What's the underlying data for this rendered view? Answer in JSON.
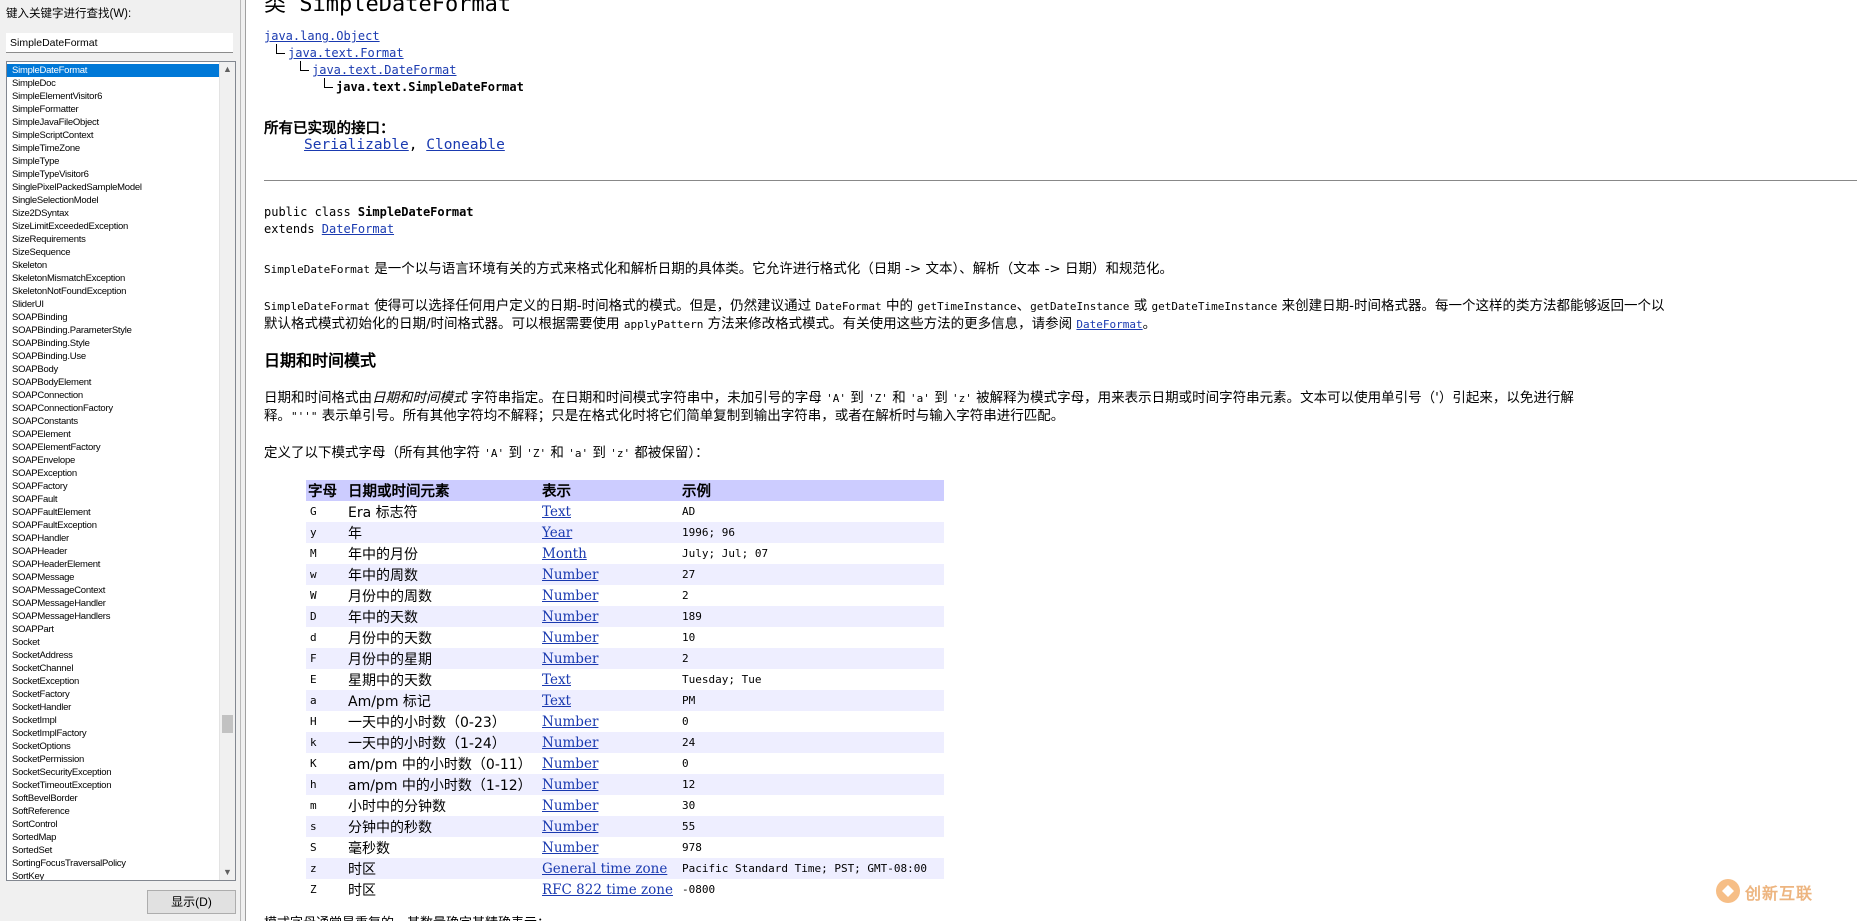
{
  "left_pane": {
    "search_label": "键入关键字进行查找(W):",
    "search_value": "SimpleDateFormat",
    "show_button": "显示(D)",
    "index_items": [
      "SimpleDateFormat",
      "SimpleDoc",
      "SimpleElementVisitor6",
      "SimpleFormatter",
      "SimpleJavaFileObject",
      "SimpleScriptContext",
      "SimpleTimeZone",
      "SimpleType",
      "SimpleTypeVisitor6",
      "SinglePixelPackedSampleModel",
      "SingleSelectionModel",
      "Size2DSyntax",
      "SizeLimitExceededException",
      "SizeRequirements",
      "SizeSequence",
      "Skeleton",
      "SkeletonMismatchException",
      "SkeletonNotFoundException",
      "SliderUI",
      "SOAPBinding",
      "SOAPBinding.ParameterStyle",
      "SOAPBinding.Style",
      "SOAPBinding.Use",
      "SOAPBody",
      "SOAPBodyElement",
      "SOAPConnection",
      "SOAPConnectionFactory",
      "SOAPConstants",
      "SOAPElement",
      "SOAPElementFactory",
      "SOAPEnvelope",
      "SOAPException",
      "SOAPFactory",
      "SOAPFault",
      "SOAPFaultElement",
      "SOAPFaultException",
      "SOAPHandler",
      "SOAPHeader",
      "SOAPHeaderElement",
      "SOAPMessage",
      "SOAPMessageContext",
      "SOAPMessageHandler",
      "SOAPMessageHandlers",
      "SOAPPart",
      "Socket",
      "SocketAddress",
      "SocketChannel",
      "SocketException",
      "SocketFactory",
      "SocketHandler",
      "SocketImpl",
      "SocketImplFactory",
      "SocketOptions",
      "SocketPermission",
      "SocketSecurityException",
      "SocketTimeoutException",
      "SoftBevelBorder",
      "SoftReference",
      "SortControl",
      "SortedMap",
      "SortedSet",
      "SortingFocusTraversalPolicy",
      "SortKey"
    ],
    "selected_index": 0
  },
  "content": {
    "class_heading": "类 SimpleDateFormat",
    "hierarchy": [
      "java.lang.Object",
      "java.text.Format",
      "java.text.DateFormat",
      "java.text.SimpleDateFormat"
    ],
    "interfaces_heading": "所有已实现的接口：",
    "interfaces": [
      "Serializable",
      "Cloneable"
    ],
    "interfaces_sep": ", ",
    "decl_prefix": "public class ",
    "decl_class": "SimpleDateFormat",
    "decl_extends": "extends ",
    "decl_super": "DateFormat",
    "para1": {
      "code": "SimpleDateFormat",
      "text": " 是一个以与语言环境有关的方式来格式化和解析日期的具体类。它允许进行格式化（日期 -> 文本）、解析（文本 -> 日期）和规范化。"
    },
    "para2": {
      "line1_code1": "SimpleDateFormat",
      "line1_text1": " 使得可以选择任何用户定义的日期-时间格式的模式。但是，仍然建议通过 ",
      "line1_code2": "DateFormat",
      "line1_text2": " 中的 ",
      "line1_code3": "getTimeInstance",
      "line1_text3": "、",
      "line1_code4": "getDateInstance",
      "line1_text4": " 或 ",
      "line1_code5": "getDateTimeInstance",
      "line1_text5": " 来创建日期-时间格式器。每一个这样的类方法都能够返回一个以",
      "line2_text1": "默认格式模式初始化的日期/时间格式器。可以根据需要使用 ",
      "line2_code1": "applyPattern",
      "line2_text2": " 方法来修改格式模式。有关使用这些方法的更多信息，请参阅 ",
      "line2_link": "DateFormat",
      "line2_end": "。"
    },
    "pattern_heading": "日期和时间模式",
    "para3": {
      "line1_text1": "日期和时间格式由",
      "line1_em": "日期和时间模式",
      "line1_text2": " 字符串指定。在日期和时间模式字符串中，未加引号的字母 ",
      "q1": "'A'",
      "t_to1": " 到 ",
      "q2": "'Z'",
      "t_and1": " 和 ",
      "q3": "'a'",
      "t_to2": " 到 ",
      "q4": "'z'",
      "line1_text3": " 被解释为模式字母，用来表示日期或时间字符串元素。文本可以使用单引号（'）引起来，以免进行解",
      "line2_text1": "释。",
      "line2_code": "\"''\"",
      "line2_text2": " 表示单引号。所有其他字符均不解释；只是在格式化时将它们简单复制到输出字符串，或者在解析时与输入字符串进行匹配。"
    },
    "para4": {
      "text1": "定义了以下模式字母（所有其他字符 ",
      "q1": "'A'",
      "to1": " 到 ",
      "q2": "'Z'",
      "and1": " 和 ",
      "q3": "'a'",
      "to2": " 到 ",
      "q4": "'z'",
      "text2": " 都被保留）："
    },
    "table": {
      "headers": [
        "字母",
        "日期或时间元素",
        "表示",
        "示例"
      ],
      "rows": [
        [
          "G",
          "Era 标志符",
          "Text",
          "AD"
        ],
        [
          "y",
          "年",
          "Year",
          "1996; 96"
        ],
        [
          "M",
          "年中的月份",
          "Month",
          "July; Jul; 07"
        ],
        [
          "w",
          "年中的周数",
          "Number",
          "27"
        ],
        [
          "W",
          "月份中的周数",
          "Number",
          "2"
        ],
        [
          "D",
          "年中的天数",
          "Number",
          "189"
        ],
        [
          "d",
          "月份中的天数",
          "Number",
          "10"
        ],
        [
          "F",
          "月份中的星期",
          "Number",
          "2"
        ],
        [
          "E",
          "星期中的天数",
          "Text",
          "Tuesday; Tue"
        ],
        [
          "a",
          "Am/pm 标记",
          "Text",
          "PM"
        ],
        [
          "H",
          "一天中的小时数（0-23）",
          "Number",
          "0"
        ],
        [
          "k",
          "一天中的小时数（1-24）",
          "Number",
          "24"
        ],
        [
          "K",
          "am/pm 中的小时数（0-11）",
          "Number",
          "0"
        ],
        [
          "h",
          "am/pm 中的小时数（1-12）",
          "Number",
          "12"
        ],
        [
          "m",
          "小时中的分钟数",
          "Number",
          "30"
        ],
        [
          "s",
          "分钟中的秒数",
          "Number",
          "55"
        ],
        [
          "S",
          "毫秒数",
          "Number",
          "978"
        ],
        [
          "z",
          "时区",
          "General time zone",
          "Pacific Standard Time; PST; GMT-08:00"
        ],
        [
          "Z",
          "时区",
          "RFC 822 time zone",
          "-0800"
        ]
      ]
    },
    "bottom_peek": "模式字母通常是重复的，其数量确定其精确表示："
  },
  "watermark": {
    "text": "创新互联",
    "color": "#e07a1a"
  }
}
